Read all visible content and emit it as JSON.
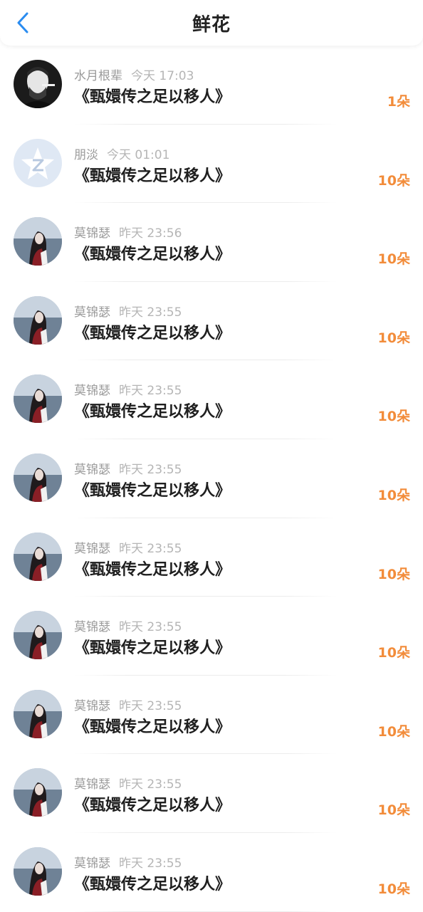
{
  "header": {
    "title": "鲜花"
  },
  "items": [
    {
      "name": "水月根辈",
      "time": "今天 17:03",
      "content": "《甄嬛传之足以移人》",
      "count": "1朵",
      "avatar": "avatar-smoker"
    },
    {
      "name": "朋淡",
      "time": "今天 01:01",
      "content": "《甄嬛传之足以移人》",
      "count": "10朵",
      "avatar": "avatar-default-z"
    },
    {
      "name": "莫锦瑟",
      "time": "昨天 23:56",
      "content": "《甄嬛传之足以移人》",
      "count": "10朵",
      "avatar": "avatar-girl"
    },
    {
      "name": "莫锦瑟",
      "time": "昨天 23:55",
      "content": "《甄嬛传之足以移人》",
      "count": "10朵",
      "avatar": "avatar-girl"
    },
    {
      "name": "莫锦瑟",
      "time": "昨天 23:55",
      "content": "《甄嬛传之足以移人》",
      "count": "10朵",
      "avatar": "avatar-girl"
    },
    {
      "name": "莫锦瑟",
      "time": "昨天 23:55",
      "content": "《甄嬛传之足以移人》",
      "count": "10朵",
      "avatar": "avatar-girl"
    },
    {
      "name": "莫锦瑟",
      "time": "昨天 23:55",
      "content": "《甄嬛传之足以移人》",
      "count": "10朵",
      "avatar": "avatar-girl"
    },
    {
      "name": "莫锦瑟",
      "time": "昨天 23:55",
      "content": "《甄嬛传之足以移人》",
      "count": "10朵",
      "avatar": "avatar-girl"
    },
    {
      "name": "莫锦瑟",
      "time": "昨天 23:55",
      "content": "《甄嬛传之足以移人》",
      "count": "10朵",
      "avatar": "avatar-girl"
    },
    {
      "name": "莫锦瑟",
      "time": "昨天 23:55",
      "content": "《甄嬛传之足以移人》",
      "count": "10朵",
      "avatar": "avatar-girl"
    },
    {
      "name": "莫锦瑟",
      "time": "昨天 23:55",
      "content": "《甄嬛传之足以移人》",
      "count": "10朵",
      "avatar": "avatar-girl"
    }
  ],
  "colors": {
    "accent": "#2a8cf0",
    "count": "#f28c3a"
  }
}
